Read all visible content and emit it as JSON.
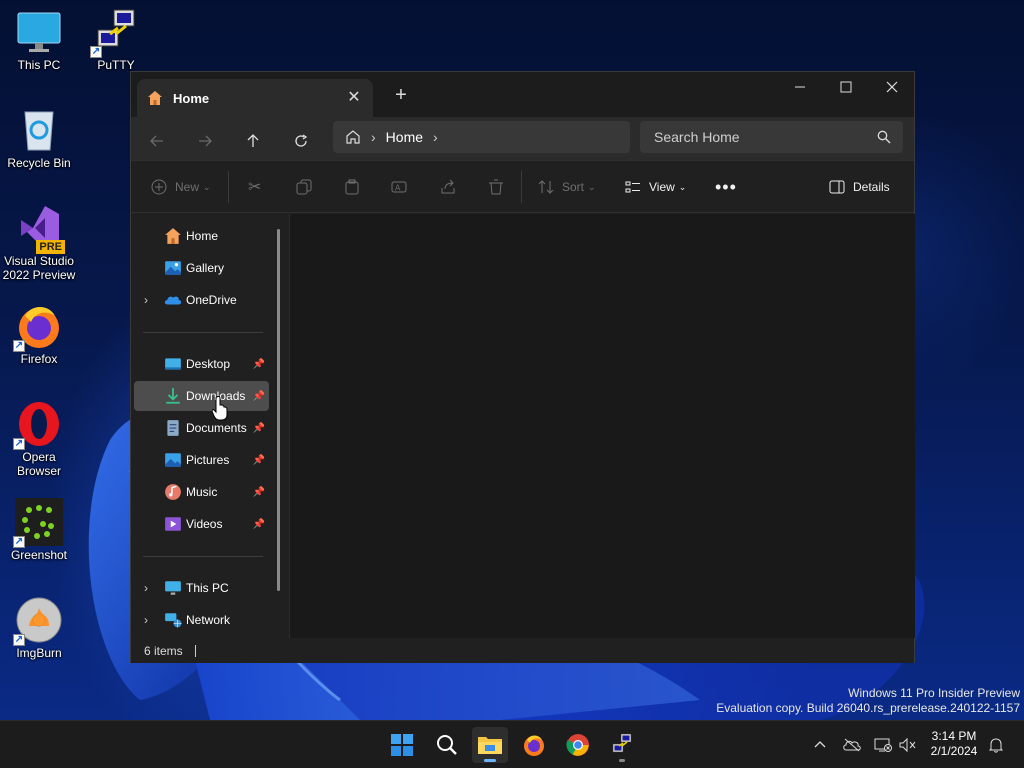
{
  "desktop": {
    "icons": [
      {
        "label": "This PC",
        "icon": "monitor-icon"
      },
      {
        "label": "PuTTY",
        "icon": "putty-icon"
      },
      {
        "label": "Recycle Bin",
        "icon": "recycle-bin-icon"
      },
      {
        "label": "Visual Studio\n2022 Preview",
        "label_line1": "Visual Studio",
        "label_line2": "2022 Preview",
        "icon": "visual-studio-icon",
        "badge": "PRE"
      },
      {
        "label": "Firefox",
        "icon": "firefox-icon"
      },
      {
        "label": "Opera Browser",
        "label_line1": "Opera",
        "label_line2": "Browser",
        "icon": "opera-icon"
      },
      {
        "label": "Greenshot",
        "icon": "greenshot-icon"
      },
      {
        "label": "ImgBurn",
        "icon": "imgburn-icon"
      }
    ],
    "watermark_line1": "Windows 11 Pro Insider Preview",
    "watermark_line2": "Evaluation copy. Build 26040.rs_prerelease.240122-1157"
  },
  "explorer": {
    "tab_title": "Home",
    "address": {
      "crumb": "Home"
    },
    "search": {
      "placeholder": "Search Home"
    },
    "toolbar": {
      "new_label": "New",
      "sort_label": "Sort",
      "view_label": "View",
      "details_label": "Details"
    },
    "nav": {
      "quick": [
        {
          "label": "Home",
          "icon": "home-icon"
        },
        {
          "label": "Gallery",
          "icon": "gallery-icon"
        },
        {
          "label": "OneDrive",
          "icon": "onedrive-icon"
        }
      ],
      "pinned": [
        {
          "label": "Desktop",
          "icon": "desktop-folder-icon"
        },
        {
          "label": "Downloads",
          "icon": "downloads-icon"
        },
        {
          "label": "Documents",
          "icon": "documents-icon"
        },
        {
          "label": "Pictures",
          "icon": "pictures-icon"
        },
        {
          "label": "Music",
          "icon": "music-icon"
        },
        {
          "label": "Videos",
          "icon": "videos-icon"
        }
      ],
      "devices": [
        {
          "label": "This PC",
          "icon": "this-pc-icon"
        },
        {
          "label": "Network",
          "icon": "network-icon"
        }
      ],
      "selected": "Downloads"
    },
    "status": {
      "item_count": "6 items"
    }
  },
  "taskbar": {
    "time": "3:14 PM",
    "date": "2/1/2024",
    "apps": [
      "start-icon",
      "search-icon",
      "file-explorer-icon",
      "firefox-icon",
      "chrome-icon",
      "putty-icon"
    ]
  }
}
